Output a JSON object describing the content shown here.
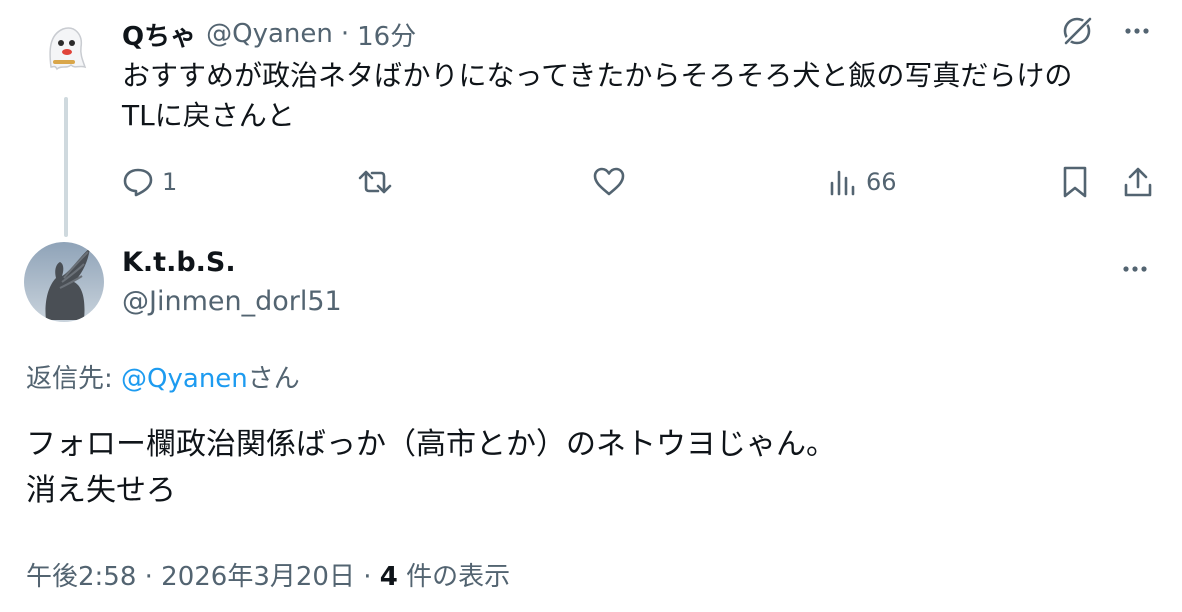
{
  "parent_tweet": {
    "display_name": "Qちゃ",
    "handle": "@Qyanen",
    "separator": "·",
    "time": "16分",
    "text_line1": "おすすめが政治ネタばかりになってきたからそろそろ犬と飯の写真だらけの",
    "text_line2": "TLに戻さんと",
    "actions": {
      "reply_count": "1",
      "retweet_count": "",
      "like_count": "",
      "views_count": "66"
    },
    "icons": {
      "grok": "grok-icon",
      "more": "more-icon",
      "reply": "reply-icon",
      "retweet": "retweet-icon",
      "like": "heart-icon",
      "views": "views-icon",
      "bookmark": "bookmark-icon",
      "share": "share-icon"
    }
  },
  "reply_tweet": {
    "display_name": "K.t.b.S.",
    "handle": "@Jinmen_dorl51",
    "reply_to_prefix": "返信先: ",
    "reply_to_handle": "@Qyanen",
    "reply_to_suffix": "さん",
    "text_line1": "フォロー欄政治関係ばっか（高市とか）のネトウヨじゃん。",
    "text_line2": "消え失せろ",
    "timestamp": "午後2:58 · 2026年3月20日 · ",
    "view_count": "4",
    "view_suffix": " 件の表示"
  },
  "colors": {
    "text_primary": "#0f1419",
    "text_secondary": "#536471",
    "link": "#1d9bf0",
    "thread_line": "#cfd9de"
  }
}
